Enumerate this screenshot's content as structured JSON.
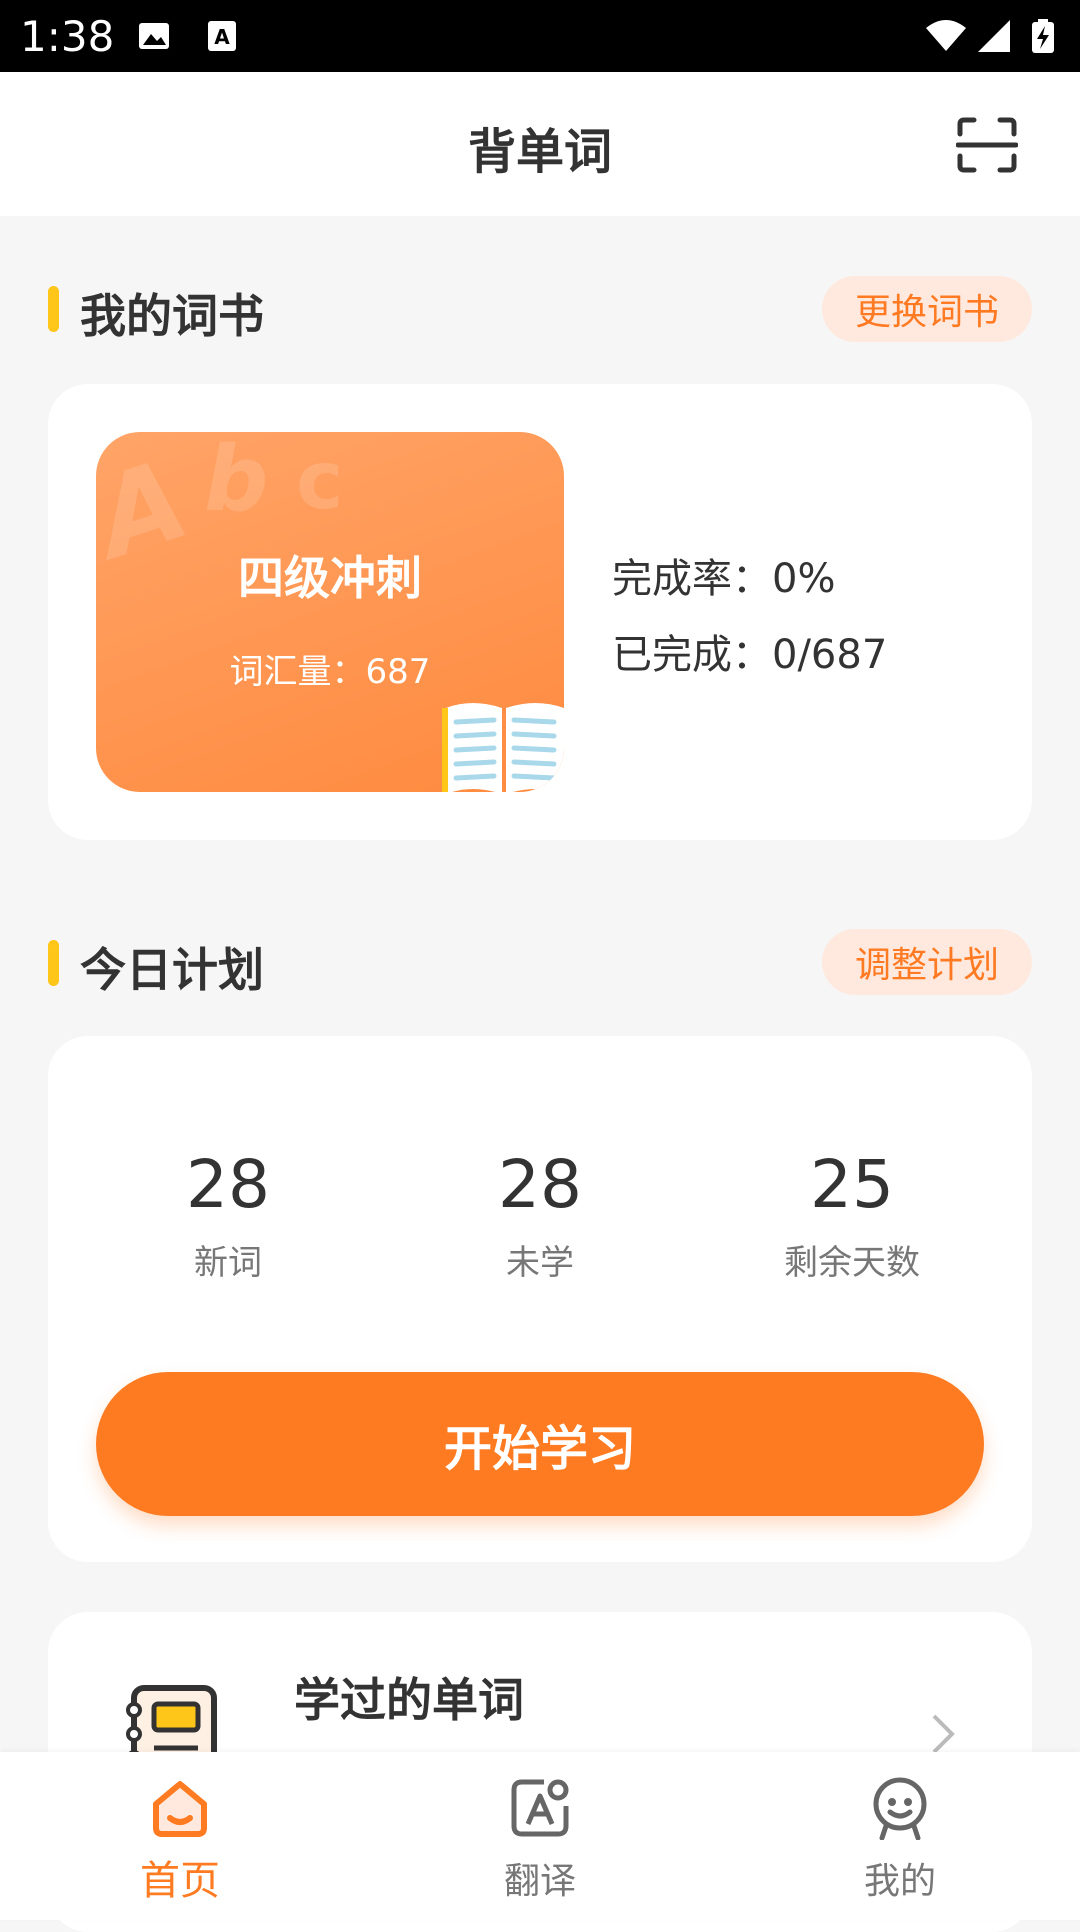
{
  "status_bar": {
    "time": "1:38"
  },
  "header": {
    "title": "背单词"
  },
  "my_wordbook": {
    "section_title": "我的词书",
    "change_button": "更换词书",
    "book": {
      "title": "四级冲刺",
      "vocab_label": "词汇量：",
      "vocab_count": "687",
      "cover_letters": "Abc"
    },
    "completion_rate_label": "完成率：",
    "completion_rate": "0%",
    "completed_label": "已完成：",
    "completed": "0/687"
  },
  "today_plan": {
    "section_title": "今日计划",
    "adjust_button": "调整计划",
    "stats": [
      {
        "value": "28",
        "label": "新词"
      },
      {
        "value": "28",
        "label": "未学"
      },
      {
        "value": "25",
        "label": "剩余天数"
      }
    ],
    "start_button": "开始学习"
  },
  "learned_words": {
    "title": "学过的单词"
  },
  "bottom_nav": {
    "items": [
      {
        "label": "首页",
        "icon": "home-icon",
        "active": true
      },
      {
        "label": "翻译",
        "icon": "translate-icon",
        "active": false
      },
      {
        "label": "我的",
        "icon": "profile-icon",
        "active": false
      }
    ],
    "accent_color": "#ff7b22"
  },
  "colors": {
    "accent": "#ff7b22",
    "section_marker": "#ffc61a",
    "pill_bg": "#ffe9de"
  }
}
